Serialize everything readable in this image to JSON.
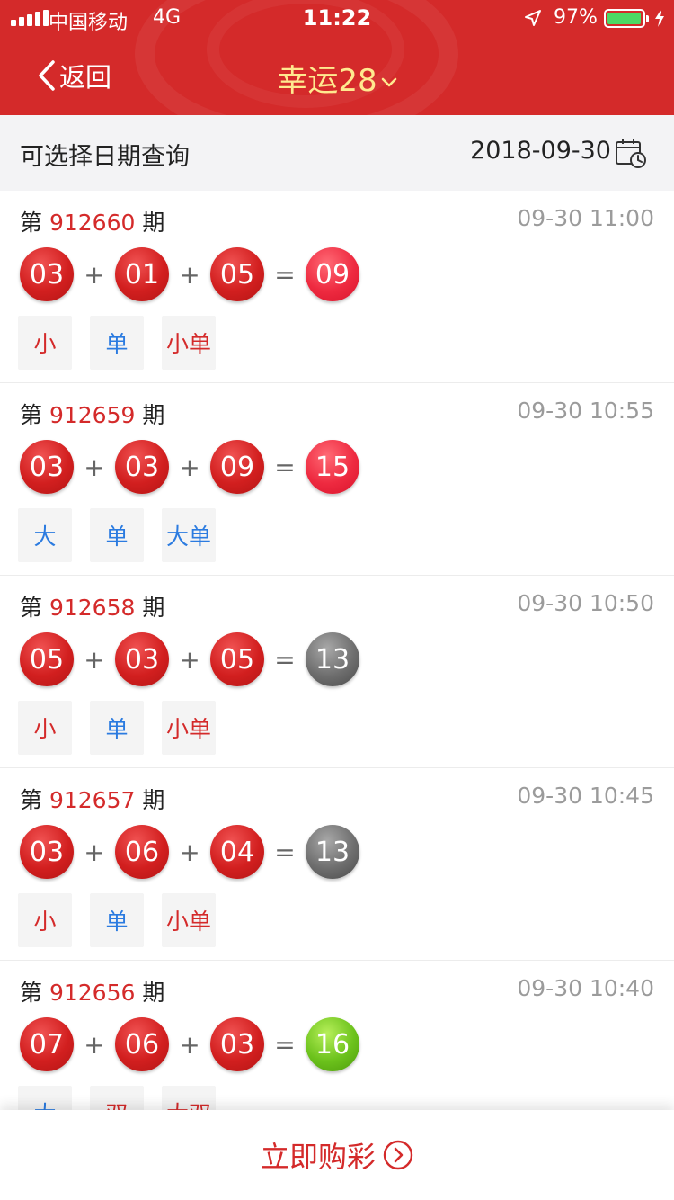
{
  "status_bar": {
    "carrier": "中国移动",
    "network": "4G",
    "time": "11:22",
    "battery_percent": "97%",
    "battery_level": 0.97
  },
  "nav": {
    "back_label": "返回",
    "title": "幸运28"
  },
  "date_filter": {
    "label": "可选择日期查询",
    "date": "2018-09-30"
  },
  "rows": [
    {
      "prefix": "第",
      "issue": "912660",
      "suffix": "期",
      "time": "09-30 11:00",
      "n1": "03",
      "n2": "01",
      "n3": "05",
      "plus": "+",
      "equals": "=",
      "sum": "09",
      "sum_color": "red",
      "tags": [
        "小",
        "单",
        "小单"
      ]
    },
    {
      "prefix": "第",
      "issue": "912659",
      "suffix": "期",
      "time": "09-30 10:55",
      "n1": "03",
      "n2": "03",
      "n3": "09",
      "plus": "+",
      "equals": "=",
      "sum": "15",
      "sum_color": "red",
      "tags": [
        "大",
        "单",
        "大单"
      ]
    },
    {
      "prefix": "第",
      "issue": "912658",
      "suffix": "期",
      "time": "09-30 10:50",
      "n1": "05",
      "n2": "03",
      "n3": "05",
      "plus": "+",
      "equals": "=",
      "sum": "13",
      "sum_color": "gray",
      "tags": [
        "小",
        "单",
        "小单"
      ]
    },
    {
      "prefix": "第",
      "issue": "912657",
      "suffix": "期",
      "time": "09-30 10:45",
      "n1": "03",
      "n2": "06",
      "n3": "04",
      "plus": "+",
      "equals": "=",
      "sum": "13",
      "sum_color": "gray",
      "tags": [
        "小",
        "单",
        "小单"
      ]
    },
    {
      "prefix": "第",
      "issue": "912656",
      "suffix": "期",
      "time": "09-30 10:40",
      "n1": "07",
      "n2": "06",
      "n3": "03",
      "plus": "+",
      "equals": "=",
      "sum": "16",
      "sum_color": "green",
      "tags": [
        "大",
        "双",
        "大双"
      ]
    }
  ],
  "colors": {
    "brand_red": "#d42a2a",
    "title_yellow": "#ffe98f",
    "tag_blue": "#2b7be0",
    "battery_green": "#4cd964"
  },
  "icons": {
    "back": "chevron-left-icon",
    "title_dropdown": "chevron-down-icon",
    "calendar": "calendar-clock-icon",
    "buy_arrow": "circle-arrow-right-icon"
  },
  "buy_button": {
    "label": "立即购彩"
  }
}
